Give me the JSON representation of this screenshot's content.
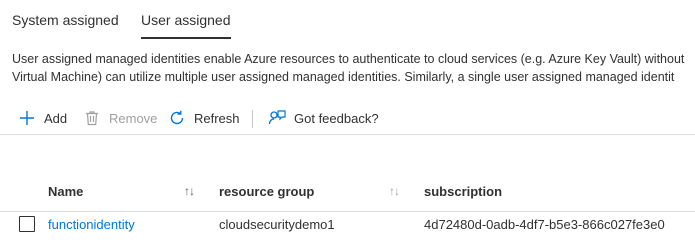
{
  "tabs": [
    {
      "label": "System assigned",
      "active": false
    },
    {
      "label": "User assigned",
      "active": true
    }
  ],
  "description": {
    "line1": "User assigned managed identities enable Azure resources to authenticate to cloud services (e.g. Azure Key Vault) without",
    "line2": "Virtual Machine) can utilize multiple user assigned managed identities. Similarly, a single user assigned managed identit"
  },
  "toolbar": {
    "add": {
      "label": "Add",
      "icon": "plus-icon"
    },
    "remove": {
      "label": "Remove",
      "icon": "trash-icon",
      "disabled": true
    },
    "refresh": {
      "label": "Refresh",
      "icon": "refresh-icon"
    },
    "feedback": {
      "label": "Got feedback?",
      "icon": "feedback-icon"
    }
  },
  "table": {
    "columns": [
      {
        "label": "Name",
        "sort_icon": "↑↓"
      },
      {
        "label": "resource group",
        "sort_icon": "↑↓"
      },
      {
        "label": "subscription"
      }
    ],
    "rows": [
      {
        "name": "functionidentity",
        "resource_group": "cloudsecuritydemo1",
        "subscription": "4d72480d-0adb-4df7-b5e3-866c027fe3e0"
      }
    ]
  },
  "colors": {
    "accent": "#0078d4",
    "text": "#323130",
    "disabled": "#a19f9d",
    "divider": "#e1dfdd"
  }
}
